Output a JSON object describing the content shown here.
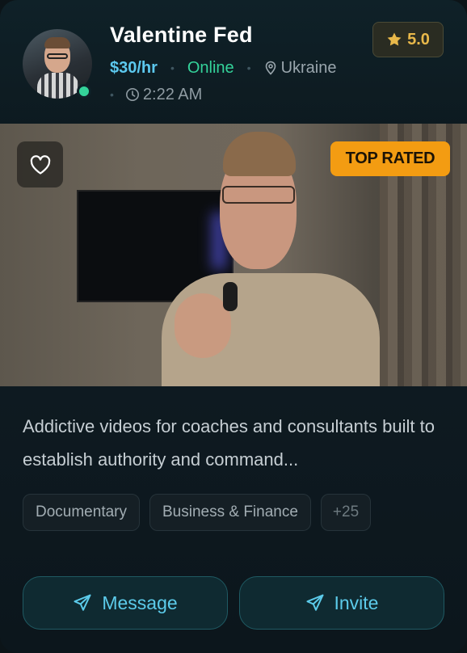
{
  "profile": {
    "name": "Valentine Fed",
    "rate": "$30/hr",
    "status": "Online",
    "location": "Ukraine",
    "local_time": "2:22 AM",
    "rating": "5.0",
    "avatar_icon": "user-avatar"
  },
  "video": {
    "badge": "TOP RATED",
    "favorite_icon": "heart-icon"
  },
  "description": "Addictive videos for coaches and consultants built to establish authority and command...",
  "tags": [
    "Documentary",
    "Business & Finance",
    "+25"
  ],
  "actions": {
    "message_label": "Message",
    "invite_label": "Invite",
    "icon": "send-icon"
  },
  "colors": {
    "accent": "#5ccbea",
    "online": "#34d39a",
    "star": "#e8b84a",
    "badge": "#f39c12"
  }
}
